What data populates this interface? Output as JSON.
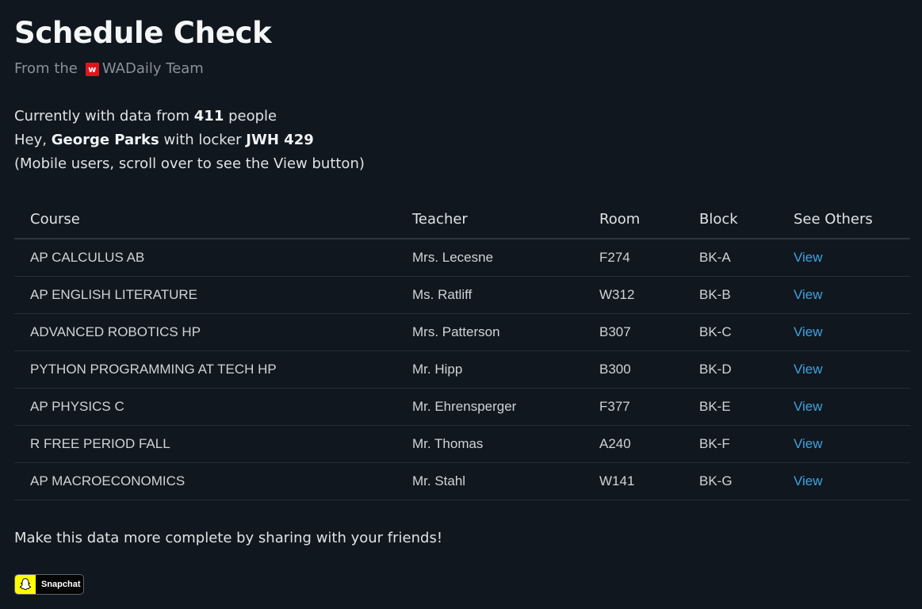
{
  "header": {
    "title": "Schedule Check",
    "byline_prefix": "From the",
    "logo_letter": "w",
    "team_name": "WADaily Team"
  },
  "info": {
    "line1_prefix": "Currently with data from",
    "people_count": "411",
    "line1_suffix": "people",
    "line2_prefix": "Hey,",
    "user_name": "George Parks",
    "line2_middle": "with locker",
    "locker": "JWH 429",
    "mobile_note": "(Mobile users, scroll over to see the View button)"
  },
  "table": {
    "headers": [
      "Course",
      "Teacher",
      "Room",
      "Block",
      "See Others"
    ],
    "rows": [
      {
        "course": "AP CALCULUS AB",
        "teacher": "Mrs. Lecesne",
        "room": "F274",
        "block": "BK-A",
        "action": "View"
      },
      {
        "course": "AP ENGLISH LITERATURE",
        "teacher": "Ms. Ratliff",
        "room": "W312",
        "block": "BK-B",
        "action": "View"
      },
      {
        "course": "ADVANCED ROBOTICS HP",
        "teacher": "Mrs. Patterson",
        "room": "B307",
        "block": "BK-C",
        "action": "View"
      },
      {
        "course": "PYTHON PROGRAMMING AT TECH HP",
        "teacher": "Mr. Hipp",
        "room": "B300",
        "block": "BK-D",
        "action": "View"
      },
      {
        "course": "AP PHYSICS C",
        "teacher": "Mr. Ehrensperger",
        "room": "F377",
        "block": "BK-E",
        "action": "View"
      },
      {
        "course": "R FREE PERIOD FALL",
        "teacher": "Mr. Thomas",
        "room": "A240",
        "block": "BK-F",
        "action": "View"
      },
      {
        "course": "AP MACROECONOMICS",
        "teacher": "Mr. Stahl",
        "room": "W141",
        "block": "BK-G",
        "action": "View"
      }
    ]
  },
  "share": {
    "message": "Make this data more complete by sharing with your friends!",
    "snapchat_label": "Snapchat",
    "snapchat_icon": "snapchat-ghost-icon"
  },
  "colors": {
    "background": "#10171e",
    "link": "#3ea3df",
    "logo": "#e2141b",
    "snapchat_yellow": "#fffc00"
  }
}
